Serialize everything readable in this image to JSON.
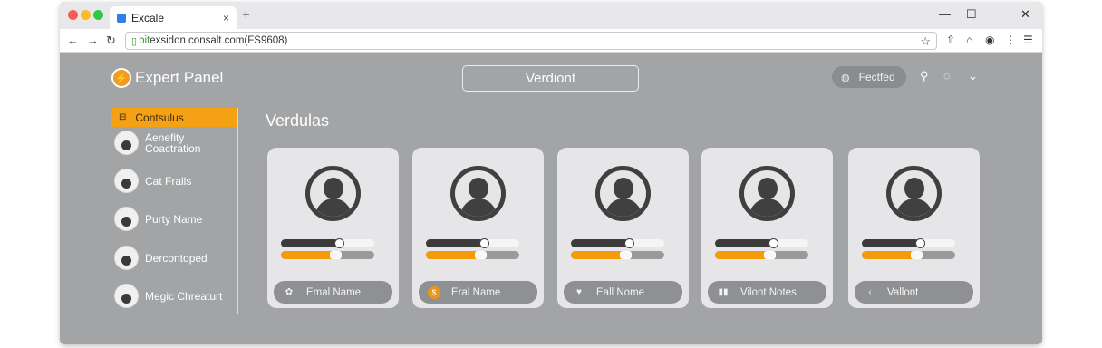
{
  "browser": {
    "tab_title": "Excale",
    "tab_close": "×",
    "new_tab": "+",
    "url_prefix": "bit",
    "url_main": "exsidon consalt.com",
    "url_suffix": " (FS9608)",
    "window_controls": [
      "—",
      "☐",
      "✕"
    ]
  },
  "header": {
    "brand": "Expert Panel",
    "search_label": "Verdiont",
    "pill_label": "Fectfed"
  },
  "sidebar": {
    "active_label": "Contsulus",
    "items": [
      {
        "label_line1": "Aenefity",
        "label_line2": "Coactration"
      },
      {
        "label_line1": "Cat Fralls",
        "label_line2": ""
      },
      {
        "label_line1": "Purty Name",
        "label_line2": ""
      },
      {
        "label_line1": "Dercontoped",
        "label_line2": ""
      },
      {
        "label_line1": "Megic Chreaturt",
        "label_line2": ""
      }
    ]
  },
  "main": {
    "section_title": "Verdulas",
    "cards": [
      {
        "button_label": "Emal Name",
        "button_icon": "gear-icon",
        "dark_value": 0.62,
        "orange_value": 0.58
      },
      {
        "button_label": "Eral Name",
        "button_icon": "coin-icon",
        "dark_value": 0.62,
        "orange_value": 0.58
      },
      {
        "button_label": "Eall Nome",
        "button_icon": "heart-icon",
        "dark_value": 0.62,
        "orange_value": 0.58
      },
      {
        "button_label": "Vilont Notes",
        "button_icon": "grid-icon",
        "dark_value": 0.62,
        "orange_value": 0.58
      },
      {
        "button_label": "Vallont",
        "button_icon": "back-icon",
        "dark_value": 0.62,
        "orange_value": 0.58
      }
    ]
  },
  "colors": {
    "accent": "#f5a114",
    "content_bg": "#a3a4a6",
    "card_bg": "#e6e6e8"
  }
}
